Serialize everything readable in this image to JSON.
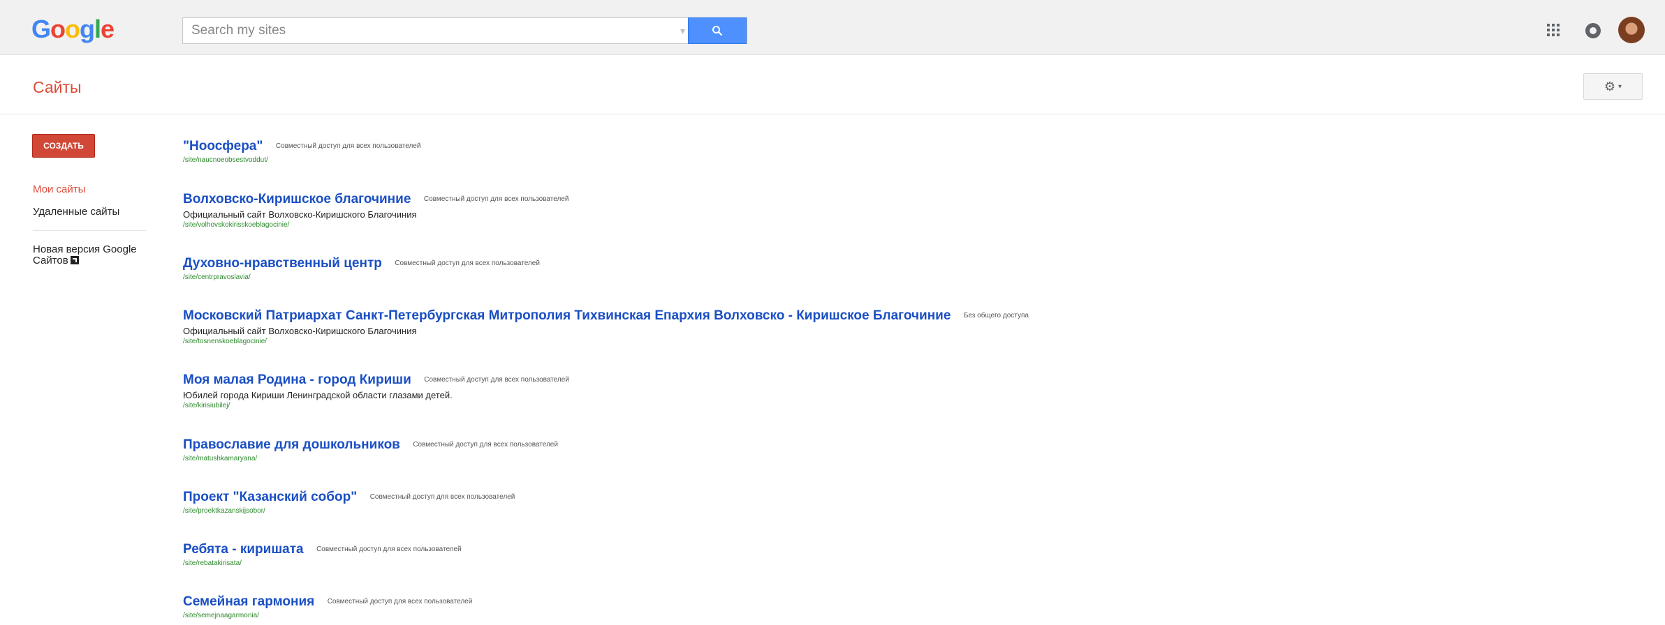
{
  "header": {
    "logo": "Google",
    "search_placeholder": "Search my sites"
  },
  "app": {
    "title": "Сайты"
  },
  "sidebar": {
    "create_label": "Создать",
    "items": [
      {
        "label": "Мои сайты"
      },
      {
        "label": "Удаленные сайты"
      }
    ],
    "new_version_label": "Новая версия Google Сайтов"
  },
  "sites": [
    {
      "title": "\"Ноосфера\"",
      "sharing": "Совместный доступ для всех пользователей",
      "description": "",
      "url": "/site/naucnoeobsestvoddut/"
    },
    {
      "title": "Волховско-Киришское благочиние",
      "sharing": "Совместный доступ для всех пользователей",
      "description": "Официальный сайт Волховско-Киришского Благочиния",
      "url": "/site/volhovskokirisskoeblagocinie/"
    },
    {
      "title": "Духовно-нравственный центр",
      "sharing": "Совместный доступ для всех пользователей",
      "description": "",
      "url": "/site/centrpravoslavia/"
    },
    {
      "title": "Московский Патриархат Санкт-Петербургская Митрополия Тихвинская Епархия Волховско - Киришское Благочиние",
      "sharing": "Без общего доступа",
      "description": "Официальный сайт Волховско-Киришского Благочиния",
      "url": "/site/tosnenskoeblagocinie/"
    },
    {
      "title": "Моя малая Родина - город Кириши",
      "sharing": "Совместный доступ для всех пользователей",
      "description": "Юбилей города Кириши Ленинградской области глазами детей.",
      "url": "/site/kirisiubilej/"
    },
    {
      "title": "Православие для дошкольников",
      "sharing": "Совместный доступ для всех пользователей",
      "description": "",
      "url": "/site/matushkamaryana/"
    },
    {
      "title": "Проект \"Казанский собор\"",
      "sharing": "Совместный доступ для всех пользователей",
      "description": "",
      "url": "/site/proektkazanskijsobor/"
    },
    {
      "title": "Ребята - киришата",
      "sharing": "Совместный доступ для всех пользователей",
      "description": "",
      "url": "/site/rebatakirisata/"
    },
    {
      "title": "Семейная гармония",
      "sharing": "Совместный доступ для всех пользователей",
      "description": "",
      "url": "/site/semejnaagarmonia/"
    }
  ]
}
